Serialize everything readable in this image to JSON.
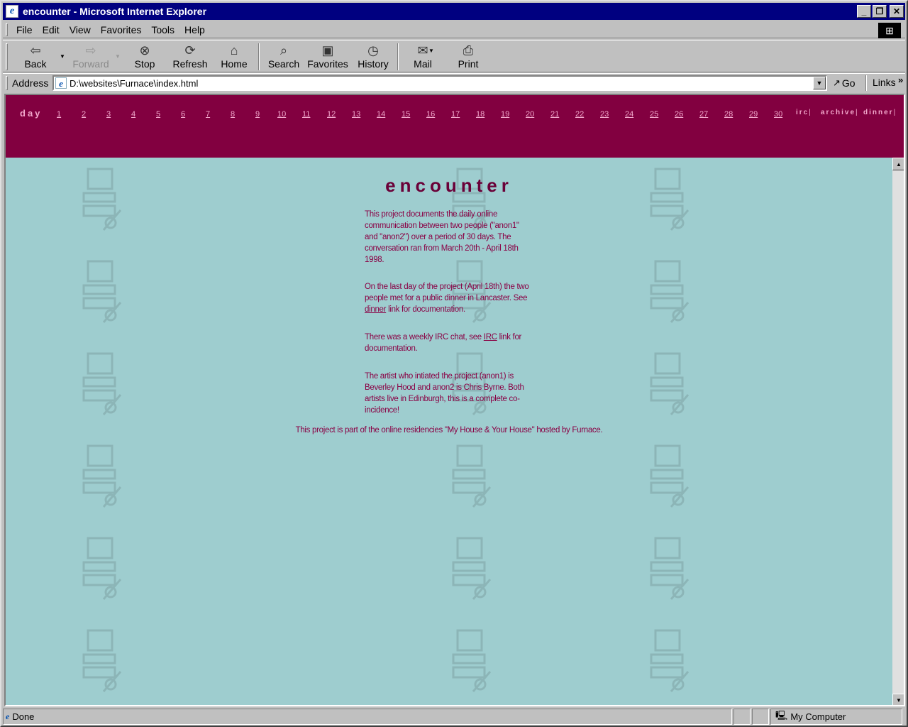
{
  "window": {
    "title": "encounter - Microsoft Internet Explorer"
  },
  "menu": [
    "File",
    "Edit",
    "View",
    "Favorites",
    "Tools",
    "Help"
  ],
  "toolbar": {
    "back": "Back",
    "forward": "Forward",
    "stop": "Stop",
    "refresh": "Refresh",
    "home": "Home",
    "search": "Search",
    "favorites": "Favorites",
    "history": "History",
    "mail": "Mail",
    "print": "Print"
  },
  "address": {
    "label": "Address",
    "value": "D:\\websites\\Furnace\\index.html",
    "go": "Go",
    "links": "Links"
  },
  "nav": {
    "day_label": "day",
    "days": [
      "1",
      "2",
      "3",
      "4",
      "5",
      "6",
      "7",
      "8",
      "9",
      "10",
      "11",
      "12",
      "13",
      "14",
      "15",
      "16",
      "17",
      "18",
      "19",
      "20",
      "21",
      "22",
      "23",
      "24",
      "25",
      "26",
      "27",
      "28",
      "29",
      "30"
    ],
    "irc": "irc",
    "archive": "archive",
    "dinner": "dinner",
    "bar": "|"
  },
  "content": {
    "heading": "encounter",
    "p1": "This project documents the daily online communication between two people (\"anon1\" and \"anon2\") over a period of 30 days. The conversation ran from March 20th - April 18th 1998.",
    "p2_before": "On the last day of the project (April 18th) the two people met for a public dinner in Lancaster. See ",
    "p2_link": "dinner",
    "p2_after": " link for documentation.",
    "p3_before": "There was a weekly IRC chat, see ",
    "p3_link": "IRC",
    "p3_after": " link for documentation.",
    "p4": "The artist who intiated the project (anon1) is Beverley Hood and anon2 is Chris Byrne. Both artists live in Edinburgh, this is a complete co-incidence!",
    "footer": "This project is part of the online residencies \"My House & Your House\" hosted by Furnace."
  },
  "status": {
    "text": "Done",
    "zone": "My Computer"
  },
  "colors": {
    "nav_bg": "#820040",
    "page_bg": "#9ecdcf",
    "text": "#8a0044",
    "nav_text": "#f2a8cc"
  }
}
